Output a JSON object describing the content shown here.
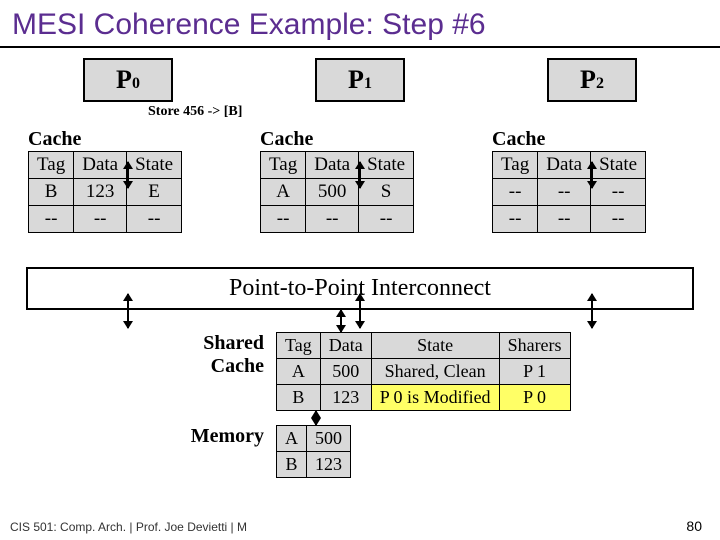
{
  "title": "MESI Coherence Example: Step #6",
  "processors": [
    {
      "name": "P",
      "sub": "0",
      "store_label": "Store 456 -> [B]",
      "cache_label": "Cache",
      "headers": [
        "Tag",
        "Data",
        "State"
      ],
      "rows": [
        [
          "B",
          "123",
          "E"
        ],
        [
          "--",
          "--",
          "--"
        ]
      ]
    },
    {
      "name": "P",
      "sub": "1",
      "cache_label": "Cache",
      "headers": [
        "Tag",
        "Data",
        "State"
      ],
      "rows": [
        [
          "A",
          "500",
          "S"
        ],
        [
          "--",
          "--",
          "--"
        ]
      ]
    },
    {
      "name": "P",
      "sub": "2",
      "cache_label": "Cache",
      "headers": [
        "Tag",
        "Data",
        "State"
      ],
      "rows": [
        [
          "--",
          "--",
          "--"
        ],
        [
          "--",
          "--",
          "--"
        ]
      ]
    }
  ],
  "interconnect": "Point-to-Point Interconnect",
  "shared_cache": {
    "label": "Shared\nCache",
    "headers": [
      "Tag",
      "Data",
      "State",
      "Sharers"
    ],
    "rows": [
      [
        "A",
        "500",
        "Shared, Clean",
        "P 1"
      ],
      [
        "B",
        "123",
        "P 0 is Modified",
        "P 0"
      ]
    ]
  },
  "memory": {
    "label": "Memory",
    "rows": [
      [
        "A",
        "500"
      ],
      [
        "B",
        "123"
      ]
    ]
  },
  "footer": "CIS 501: Comp. Arch.  |  Prof. Joe Devietti  |  M",
  "pagenum": "80"
}
